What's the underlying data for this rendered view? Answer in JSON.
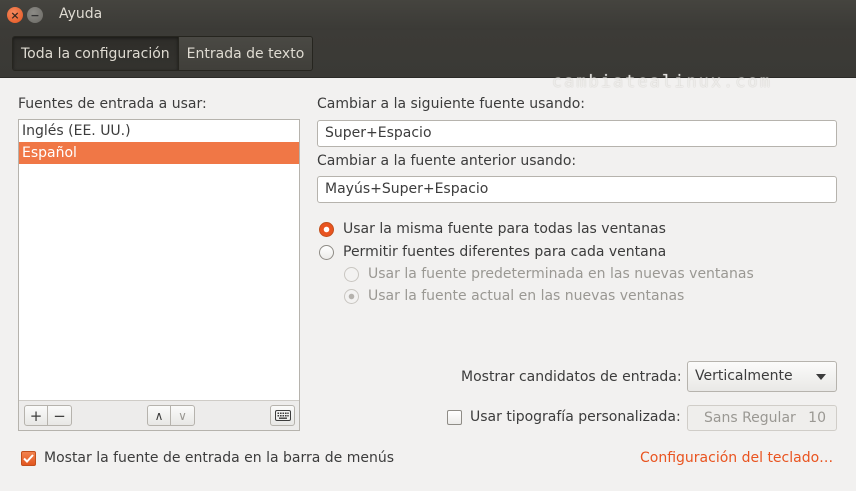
{
  "window": {
    "title": "Ayuda",
    "close_glyph": "×",
    "minimize_glyph": "−"
  },
  "tabs": [
    {
      "label": "Toda la configuración",
      "active": true
    },
    {
      "label": "Entrada de texto",
      "active": false
    }
  ],
  "watermark": "cambiatealinux.com",
  "sources": {
    "label": "Fuentes de entrada a usar:",
    "items": [
      "Inglés (EE. UU.)",
      "Español"
    ],
    "selected_index": 1,
    "add_glyph": "+",
    "remove_glyph": "−",
    "up_glyph": "∧",
    "down_glyph": "∨",
    "keyboard_icon": "keyboard-icon"
  },
  "next_source": {
    "label": "Cambiar a la siguiente fuente usando:",
    "value": "Super+Espacio"
  },
  "prev_source": {
    "label": "Cambiar a la fuente anterior usando:",
    "value": "Mayús+Super+Espacio"
  },
  "radios": {
    "same_source": "Usar la misma fuente para todas las ventanas",
    "different_sources": "Permitir fuentes diferentes para cada ventana",
    "default_source": "Usar la fuente predeterminada en las nuevas ventanas",
    "current_source": "Usar la fuente actual en las nuevas ventanas"
  },
  "candidates": {
    "label": "Mostrar candidatos de entrada:",
    "value": "Verticalmente"
  },
  "custom_font": {
    "label": "Usar tipografía personalizada:",
    "checked": false,
    "font_name": "Sans Regular",
    "font_size": "10"
  },
  "show_in_menubar": {
    "label": "Mostar la fuente de entrada en la barra de menús",
    "checked": true
  },
  "keyboard_settings_link": "Configuración del teclado…",
  "colors": {
    "accent": "#e95420",
    "selection": "#f07746",
    "titlebar": "#3c3b37",
    "background": "#f2f1f0"
  }
}
